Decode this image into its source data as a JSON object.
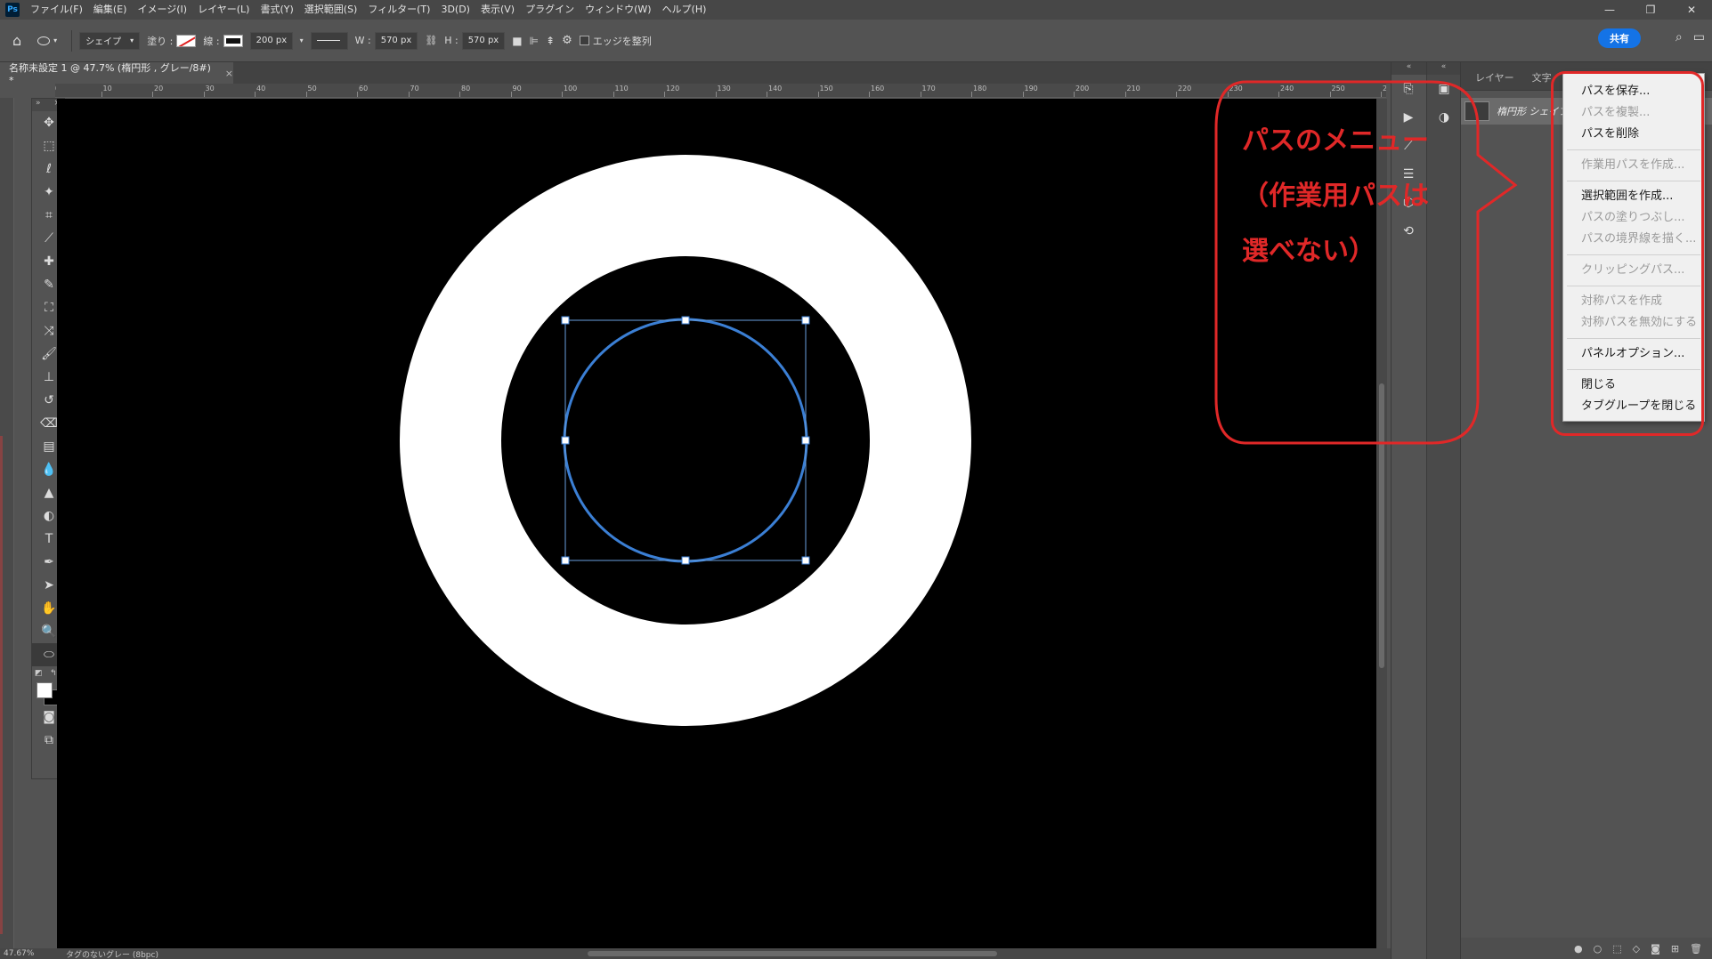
{
  "app": {
    "logo": "Ps"
  },
  "menubar": [
    "ファイル(F)",
    "編集(E)",
    "イメージ(I)",
    "レイヤー(L)",
    "書式(Y)",
    "選択範囲(S)",
    "フィルター(T)",
    "3D(D)",
    "表示(V)",
    "プラグイン",
    "ウィンドウ(W)",
    "ヘルプ(H)"
  ],
  "window_controls": {
    "minimize": "—",
    "restore": "❐",
    "close": "✕"
  },
  "options": {
    "mode": "シェイプ",
    "fill_label": "塗り :",
    "stroke_label": "線 :",
    "stroke_width": "200 px",
    "w_label": "W :",
    "w_value": "570 px",
    "h_label": "H :",
    "h_value": "570 px",
    "align_edges": "エッジを整列",
    "share": "共有"
  },
  "document": {
    "tab_title": "名称未設定 1 @ 47.7% (楕円形 , グレー/8#) *",
    "zoom": "47.67%",
    "status": "タグのないグレー (8bpc)"
  },
  "ruler": {
    "top_labels": [
      "0",
      "10",
      "20",
      "30",
      "40",
      "50",
      "60",
      "70",
      "80",
      "90",
      "100",
      "110",
      "120",
      "130",
      "140",
      "150",
      "160",
      "170",
      "180",
      "190",
      "200",
      "210",
      "220",
      "230",
      "240",
      "250",
      "260"
    ]
  },
  "panel": {
    "tabs": [
      "レイヤー",
      "文字",
      "パス"
    ],
    "active_tab": "パス",
    "path_name": "楕円形 シェイプ"
  },
  "flyout_menu": {
    "groups": [
      [
        {
          "label": "パスを保存...",
          "enabled": true
        },
        {
          "label": "パスを複製...",
          "enabled": false
        },
        {
          "label": "パスを削除",
          "enabled": true
        }
      ],
      [
        {
          "label": "作業用パスを作成...",
          "enabled": false
        }
      ],
      [
        {
          "label": "選択範囲を作成...",
          "enabled": true
        },
        {
          "label": "パスの塗りつぶし...",
          "enabled": false
        },
        {
          "label": "パスの境界線を描く...",
          "enabled": false
        }
      ],
      [
        {
          "label": "クリッピングパス...",
          "enabled": false
        }
      ],
      [
        {
          "label": "対称パスを作成",
          "enabled": false
        },
        {
          "label": "対称パスを無効にする",
          "enabled": false
        }
      ],
      [
        {
          "label": "パネルオプション...",
          "enabled": true
        }
      ],
      [
        {
          "label": "閉じる",
          "enabled": true
        },
        {
          "label": "タブグループを閉じる",
          "enabled": true
        }
      ]
    ]
  },
  "annotation": {
    "lines": [
      "パスのメニュー",
      "（作業用パスは",
      "選べない）"
    ],
    "color": "#e02828"
  },
  "colors": {
    "accent": "#1473e6",
    "path_selection": "#3b7fd4",
    "canvas": "#000000",
    "shape": "#ffffff"
  }
}
